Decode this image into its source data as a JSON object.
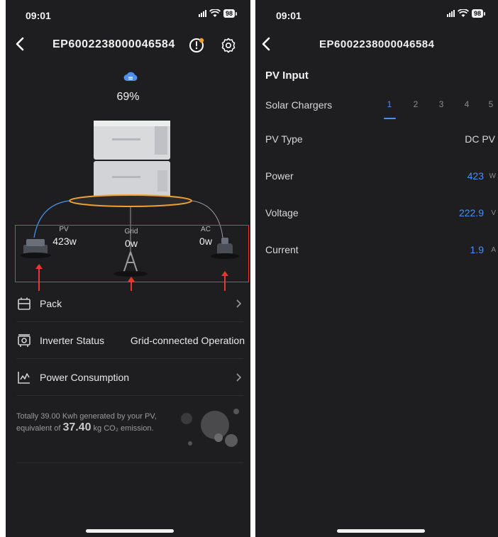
{
  "left": {
    "status_bar": {
      "time": "09:01",
      "battery": "98"
    },
    "device_id": "EP6002238000046584",
    "soc": "69%",
    "flow": {
      "pv": {
        "label": "PV",
        "value": "423w"
      },
      "grid": {
        "label": "Grid",
        "value": "0w"
      },
      "ac": {
        "label": "AC",
        "value": "0w"
      }
    },
    "menu": {
      "pack": "Pack",
      "inverter_label": "Inverter Status",
      "inverter_value": "Grid-connected Operation",
      "consumption": "Power Consumption"
    },
    "eco": {
      "prefix": "Totally 39.00 Kwh generated by your PV, equivalent of ",
      "amount": "37.40",
      "suffix": " kg CO₂ emission."
    }
  },
  "right": {
    "status_bar": {
      "time": "09:01",
      "battery": "98"
    },
    "device_id": "EP6002238000046584",
    "section_title": "PV Input",
    "solar_chargers": {
      "label": "Solar Chargers",
      "tabs": [
        "1",
        "2",
        "3",
        "4",
        "5"
      ],
      "active": "1"
    },
    "rows": {
      "pv_type": {
        "label": "PV Type",
        "value": "DC PV"
      },
      "power": {
        "label": "Power",
        "value": "423",
        "unit": "W"
      },
      "voltage": {
        "label": "Voltage",
        "value": "222.9",
        "unit": "V"
      },
      "current": {
        "label": "Current",
        "value": "1.9",
        "unit": "A"
      }
    }
  },
  "colors": {
    "accent": "#4e8ff2",
    "background": "#1e1e20",
    "highlight": "#e3392e",
    "ring": "#f0a030"
  }
}
